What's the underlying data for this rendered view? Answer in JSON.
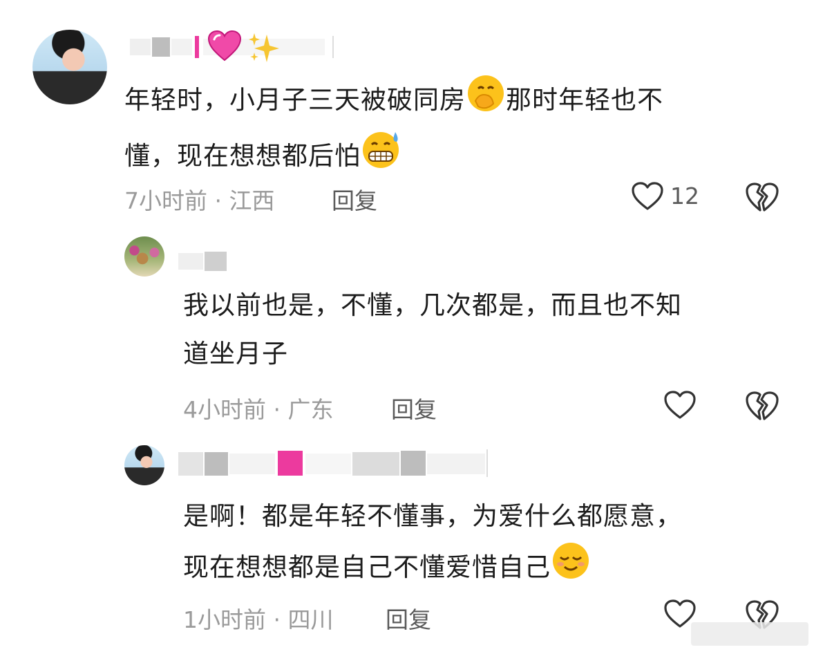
{
  "comments": [
    {
      "text_line1": "年轻时，小月子三天被破同房",
      "text_line1b": "那时年轻也不",
      "text_line2": "懂，现在想想都后怕",
      "time": "7小时前 · 江西",
      "reply_label": "回复",
      "likes": "12"
    },
    {
      "text_line1": "我以前也是，不懂，几次都是，而且也不知",
      "text_line2": "道坐月子",
      "time": "4小时前 · 广东",
      "reply_label": "回复"
    },
    {
      "text_line1": "是啊！都是年轻不懂事，为爱什么都愿意，",
      "text_line2": "现在想想都是自己不懂爱惜自己",
      "time": "1小时前 · 四川",
      "reply_label": "回复"
    }
  ],
  "colors": {
    "meta": "#9a9a9a",
    "text": "#1c1c1c",
    "icon": "#3a3a3a",
    "accent_pink": "#ec3a9e"
  }
}
